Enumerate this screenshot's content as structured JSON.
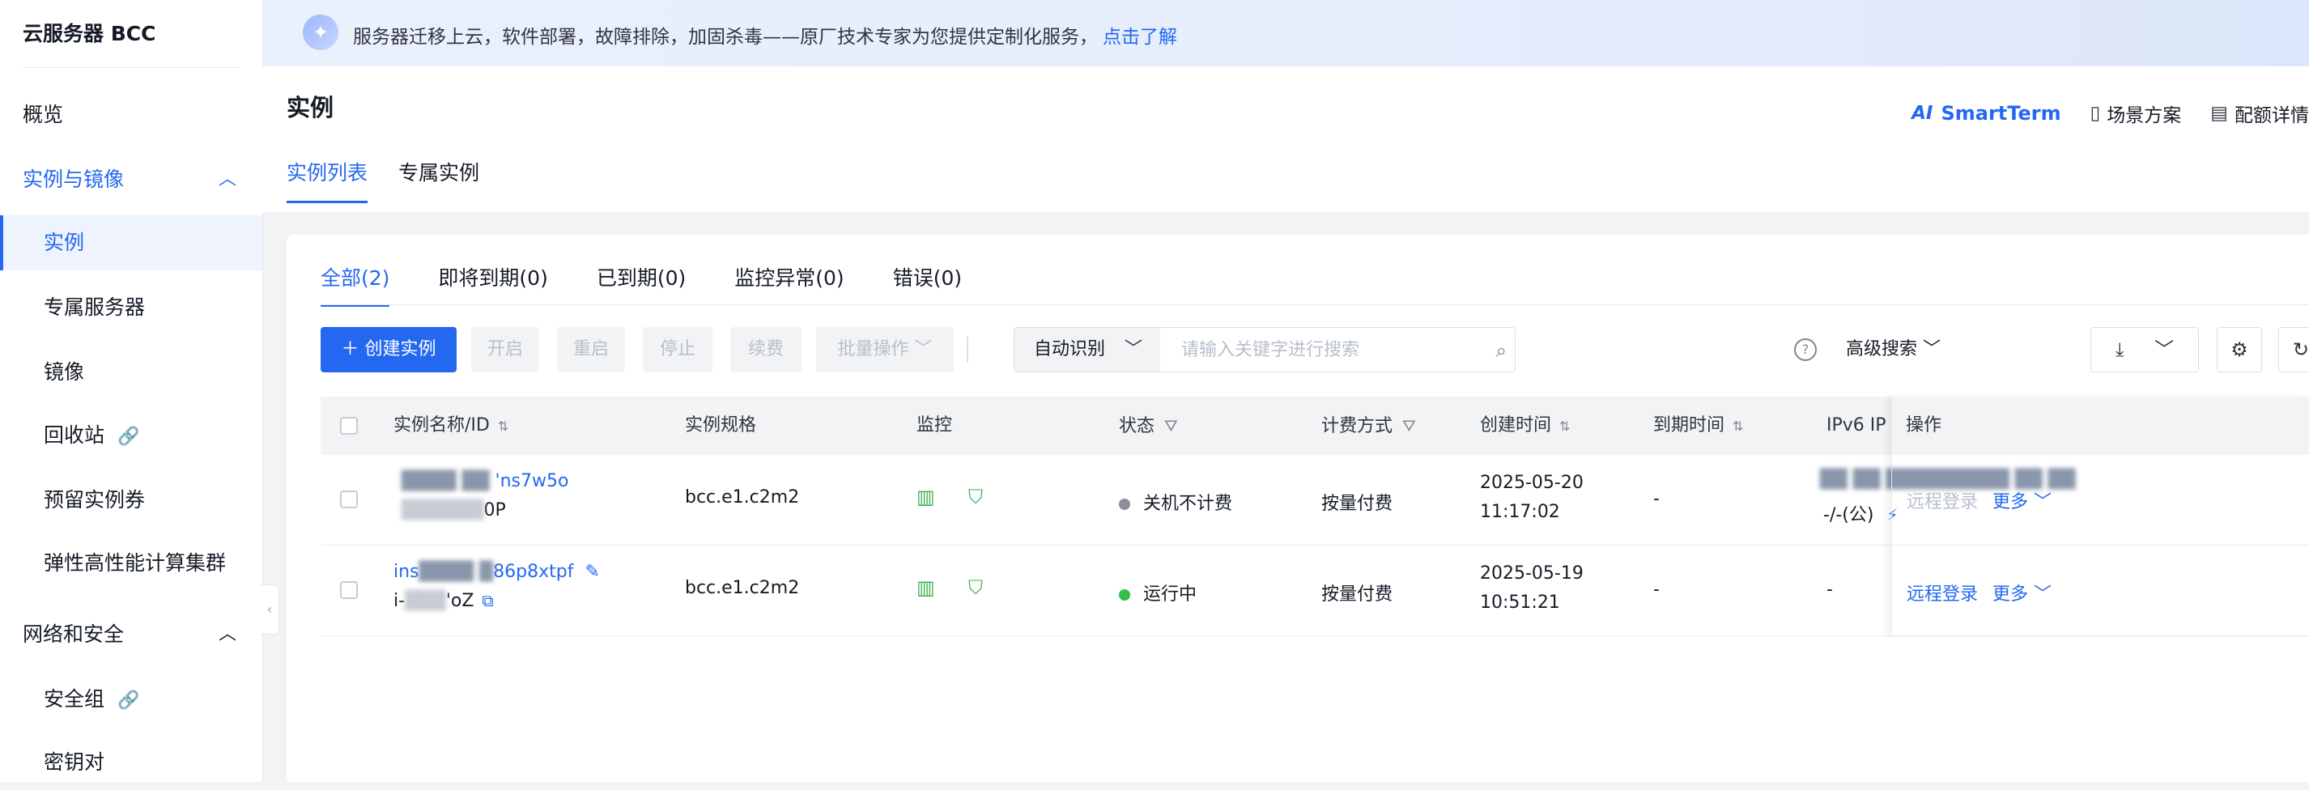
{
  "sidebar": {
    "title": "云服务器 BCC",
    "items": [
      {
        "label": "概览"
      },
      {
        "label": "实例与镜像",
        "chevron": "chevron-up-icon"
      },
      {
        "label": "实例"
      },
      {
        "label": "专属服务器"
      },
      {
        "label": "镜像"
      },
      {
        "label": "回收站"
      },
      {
        "label": "预留实例券"
      },
      {
        "label": "弹性高性能计算集群"
      },
      {
        "label": "网络和安全",
        "chevron": "chevron-up-icon"
      },
      {
        "label": "安全组"
      },
      {
        "label": "密钥对"
      }
    ]
  },
  "banner": {
    "text": "服务器迁移上云，软件部署，故障排除，加固杀毒——原厂技术专家为您提供定制化服务，",
    "link": "点击了解"
  },
  "header": {
    "title": "实例",
    "actions": {
      "ai_logo": "AI",
      "smartterm": "SmartTerm",
      "scenario": "场景方案",
      "quota": "配额详情"
    },
    "tabs": [
      "实例列表",
      "专属实例"
    ]
  },
  "status_tabs": [
    "全部(2)",
    "即将到期(0)",
    "已到期(0)",
    "监控异常(0)",
    "错误(0)"
  ],
  "toolbar": {
    "create": "创建实例",
    "start": "开启",
    "restart": "重启",
    "stop": "停止",
    "renew": "续费",
    "batch": "批量操作",
    "search_mode": "自动识别",
    "search_placeholder": "请输入关键字进行搜索",
    "advanced": "高级搜索"
  },
  "table": {
    "headers": {
      "name": "实例名称/ID",
      "spec": "实例规格",
      "monitor": "监控",
      "status": "状态",
      "billing": "计费方式",
      "created": "创建时间",
      "expire": "到期时间",
      "ipv6": "IPv6 IP",
      "ops": "操作"
    },
    "rows": [
      {
        "name_visible": "'ns7w5o",
        "id_visible": "0P",
        "spec": "bcc.e1.c2m2",
        "status": "关机不计费",
        "status_color": "#8a8f99",
        "billing": "按量付费",
        "created_date": "2025-05-20",
        "created_time": "11:17:02",
        "expire": "-",
        "ipv6_line2": "-/-(公)",
        "op_login": "远程登录",
        "op_login_enabled": false,
        "op_more": "更多"
      },
      {
        "name_visible_prefix": "ins",
        "name_visible": "86p8xtpf",
        "id_visible_prefix": "i-",
        "id_visible": "'oZ",
        "spec": "bcc.e1.c2m2",
        "status": "运行中",
        "status_color": "#30bf4a",
        "billing": "按量付费",
        "created_date": "2025-05-19",
        "created_time": "10:51:21",
        "expire": "-",
        "ipv6_line2": "-",
        "op_login": "远程登录",
        "op_login_enabled": true,
        "op_more": "更多"
      }
    ]
  },
  "colors": {
    "accent": "#2468f2",
    "monitor": "#38b24a"
  }
}
